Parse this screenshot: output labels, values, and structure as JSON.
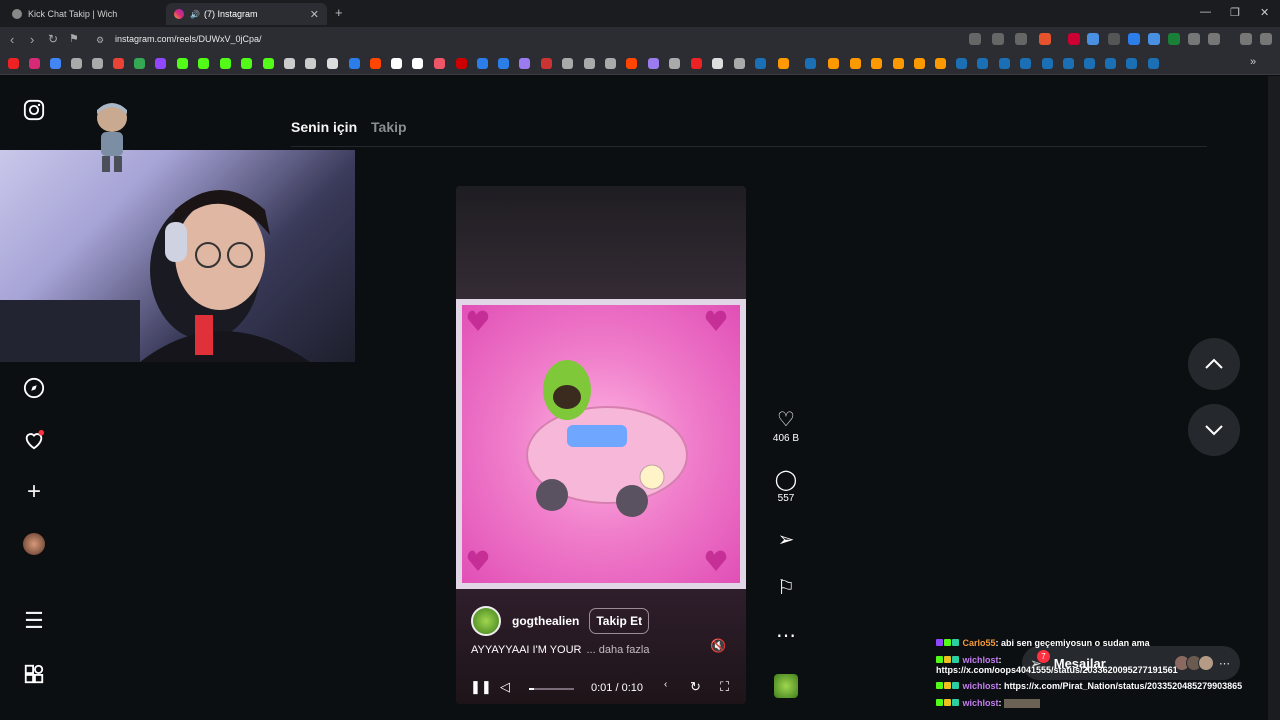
{
  "browser": {
    "tabs": [
      {
        "title": "Kick Chat Takip | Wich",
        "active": false
      },
      {
        "title": "(7) Instagram",
        "active": true
      }
    ],
    "url": "instagram.com/reels/DUWxV_0jCpa/"
  },
  "feed": {
    "tab_for_you": "Senin için",
    "tab_following": "Takip"
  },
  "reel": {
    "username": "gogthealien",
    "follow_label": "Takip Et",
    "caption": "AYYAYYAAI I'M YOUR",
    "more_label": "... daha fazla",
    "time": "0:01 / 0:10",
    "progress": 0.1,
    "likes": "406 B",
    "comments": "557"
  },
  "messages": {
    "label": "Mesajlar",
    "badge": "7"
  },
  "chat": [
    {
      "user": "Carlo55",
      "text": ": abi sen geçemiyosun o sudan ama",
      "color": "#f59a3a"
    },
    {
      "user": "wichlost",
      "text": ":",
      "color": "#c47cf0"
    },
    {
      "user": "",
      "text": "https://x.com/oops4041555/status/2033620095277191561",
      "color": "#ffffff"
    },
    {
      "user": "wichlost",
      "text": ": https://x.com/Pirat_Nation/status/2033520485279903865",
      "color": "#c47cf0"
    },
    {
      "user": "wichlost",
      "text": ":",
      "color": "#c47cf0"
    }
  ],
  "colors": {
    "background": "#0c0f12",
    "accent": "#ff3040",
    "chrome": "#2b2d33"
  }
}
